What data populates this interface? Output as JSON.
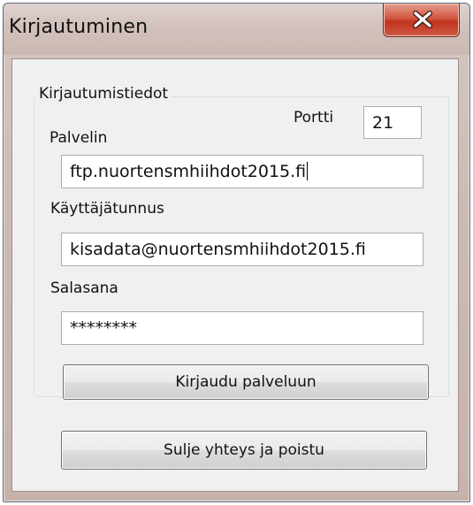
{
  "window": {
    "title": "Kirjautuminen"
  },
  "group": {
    "legend": "Kirjautumistiedot"
  },
  "server": {
    "label": "Palvelin",
    "value": "ftp.nuortensmhiihdot2015.fi"
  },
  "port": {
    "label": "Portti",
    "value": "21"
  },
  "username": {
    "label": "Käyttäjätunnus",
    "value": "kisadata@nuortensmhiihdot2015.fi"
  },
  "password": {
    "label": "Salasana",
    "value": "********"
  },
  "buttons": {
    "login": "Kirjaudu palveluun",
    "close": "Sulje yhteys ja poistu"
  },
  "icons": {
    "close": "close-icon"
  },
  "colors": {
    "close_button": "#c1331c",
    "window_frame": "#cdb9b2",
    "client_background": "#f0f0f0"
  }
}
